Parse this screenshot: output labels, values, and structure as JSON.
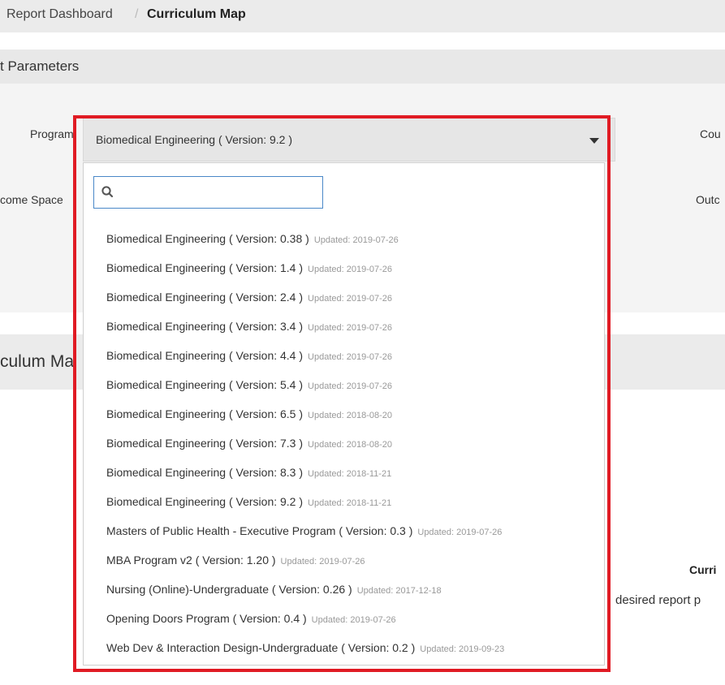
{
  "breadcrumb": {
    "parent": "Report Dashboard",
    "separator": "/",
    "current": "Curriculum Map"
  },
  "parameters": {
    "title": "t Parameters",
    "program_label": "Program",
    "outcome_space_label": "come Space",
    "course_label": "Cou",
    "outcome_label": "Outc"
  },
  "curriculum": {
    "title": "culum Ma",
    "right_title": "Curri",
    "right_text": "desired report p"
  },
  "program_select": {
    "selected": "Biomedical Engineering ( Version: 9.2 )",
    "search_value": "",
    "options": [
      {
        "label": "Biomedical Engineering ( Version: 0.38 )",
        "updated": "Updated: 2019-07-26"
      },
      {
        "label": "Biomedical Engineering ( Version: 1.4 )",
        "updated": "Updated: 2019-07-26"
      },
      {
        "label": "Biomedical Engineering ( Version: 2.4 )",
        "updated": "Updated: 2019-07-26"
      },
      {
        "label": "Biomedical Engineering ( Version: 3.4 )",
        "updated": "Updated: 2019-07-26"
      },
      {
        "label": "Biomedical Engineering ( Version: 4.4 )",
        "updated": "Updated: 2019-07-26"
      },
      {
        "label": "Biomedical Engineering ( Version: 5.4 )",
        "updated": "Updated: 2019-07-26"
      },
      {
        "label": "Biomedical Engineering ( Version: 6.5 )",
        "updated": "Updated: 2018-08-20"
      },
      {
        "label": "Biomedical Engineering ( Version: 7.3 )",
        "updated": "Updated: 2018-08-20"
      },
      {
        "label": "Biomedical Engineering ( Version: 8.3 )",
        "updated": "Updated: 2018-11-21"
      },
      {
        "label": "Biomedical Engineering ( Version: 9.2 )",
        "updated": "Updated: 2018-11-21"
      },
      {
        "label": "Masters of Public Health - Executive Program ( Version: 0.3 )",
        "updated": "Updated: 2019-07-26"
      },
      {
        "label": "MBA Program v2 ( Version: 1.20 )",
        "updated": "Updated: 2019-07-26"
      },
      {
        "label": "Nursing (Online)-Undergraduate ( Version: 0.26 )",
        "updated": "Updated: 2017-12-18"
      },
      {
        "label": "Opening Doors Program ( Version: 0.4 )",
        "updated": "Updated: 2019-07-26"
      },
      {
        "label": "Web Dev & Interaction Design-Undergraduate ( Version: 0.2 )",
        "updated": "Updated: 2019-09-23"
      }
    ]
  },
  "colors": {
    "highlight": "#e01b24",
    "search_border": "#4a88c8"
  },
  "icons": {
    "search": "search-icon",
    "caret": "caret-down-icon"
  }
}
